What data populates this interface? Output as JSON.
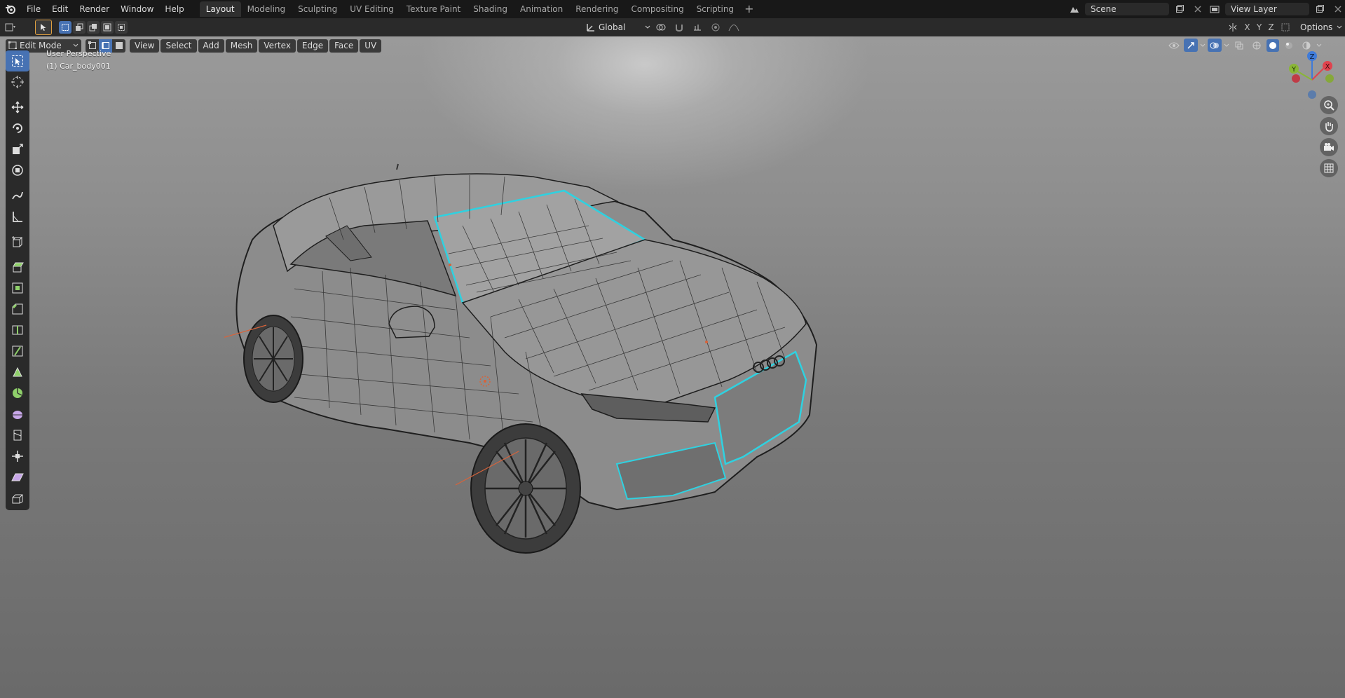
{
  "top_menu": {
    "items": [
      "File",
      "Edit",
      "Render",
      "Window",
      "Help"
    ]
  },
  "workspace_tabs": {
    "items": [
      "Layout",
      "Modeling",
      "Sculpting",
      "UV Editing",
      "Texture Paint",
      "Shading",
      "Animation",
      "Rendering",
      "Compositing",
      "Scripting"
    ],
    "active": "Layout",
    "add_label": "+"
  },
  "scene": {
    "label": "Scene"
  },
  "view_layer": {
    "label": "View Layer"
  },
  "tool_header": {
    "orientation": "Global",
    "axes": [
      "X",
      "Y",
      "Z"
    ],
    "options_label": "Options"
  },
  "viewport_header": {
    "mode": "Edit Mode",
    "menus": [
      "View",
      "Select",
      "Add",
      "Mesh",
      "Vertex",
      "Edge",
      "Face",
      "UV"
    ]
  },
  "viewport": {
    "perspective_label": "User Perspective",
    "object_label": "(1) Car_body001"
  },
  "gizmo": {
    "x_label": "X",
    "y_label": "Y",
    "z_label": "Z"
  },
  "colors": {
    "accent": "#4772b3",
    "selection_edge": "#2fd1e0",
    "active_tab": "#2f2f2f"
  }
}
